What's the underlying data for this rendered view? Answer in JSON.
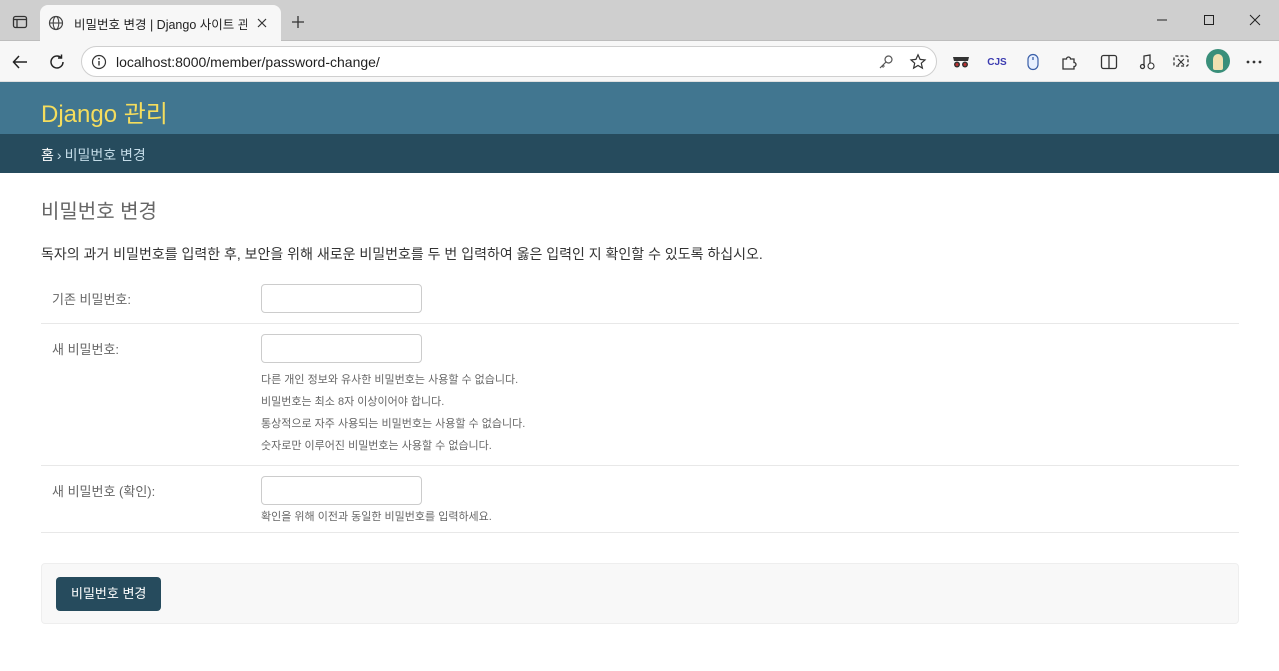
{
  "browser": {
    "tab": {
      "title": "비밀번호 변경 | Django 사이트 관",
      "favicon": "globe-icon"
    },
    "url": "localhost:8000/member/password-change/",
    "window_controls": [
      "minimize-icon",
      "maximize-icon",
      "close-icon"
    ],
    "extensions": [
      "incognito-glasses-icon",
      "cjs-extension",
      "mouse-icon",
      "puzzle-icon",
      "split-screen-icon",
      "music-note-icon",
      "screen-capture-icon",
      "profile-avatar",
      "more-options-icon"
    ],
    "extension_cjs_label": "CJS"
  },
  "admin": {
    "brand": "Django 관리",
    "breadcrumbs": {
      "home": "홈",
      "separator": "›",
      "current": "비밀번호 변경"
    },
    "colors": {
      "header": "#417690",
      "breadcrumbs": "#264b5d",
      "brand_text": "#f5dd5d",
      "button": "#264b5d"
    }
  },
  "page": {
    "title": "비밀번호 변경",
    "intro": "독자의 과거 비밀번호를 입력한 후, 보안을 위해 새로운 비밀번호를 두 번 입력하여 옳은 입력인 지 확인할 수 있도록 하십시오.",
    "fields": {
      "old_password": {
        "label": "기존 비밀번호:",
        "value": ""
      },
      "new_password1": {
        "label": "새 비밀번호:",
        "value": "",
        "help": [
          "다른 개인 정보와 유사한 비밀번호는 사용할 수 없습니다.",
          "비밀번호는 최소 8자 이상이어야 합니다.",
          "통상적으로 자주 사용되는 비밀번호는 사용할 수 없습니다.",
          "숫자로만 이루어진 비밀번호는 사용할 수 없습니다."
        ]
      },
      "new_password2": {
        "label": "새 비밀번호 (확인):",
        "value": "",
        "help": "확인을 위해 이전과 동일한 비밀번호를 입력하세요."
      }
    },
    "submit_label": "비밀번호 변경"
  }
}
